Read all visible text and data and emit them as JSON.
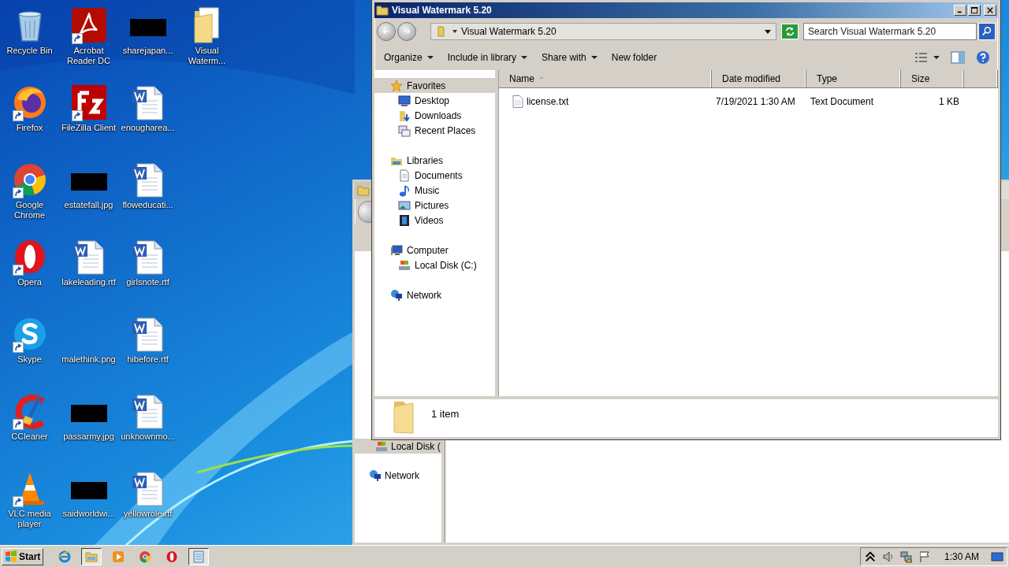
{
  "desktop": {
    "icons": [
      {
        "label": "Recycle Bin",
        "kind": "recycle-bin",
        "shortcut": false
      },
      {
        "label": "Firefox",
        "kind": "firefox",
        "shortcut": true
      },
      {
        "label": "Google Chrome",
        "kind": "chrome",
        "shortcut": true
      },
      {
        "label": "Opera",
        "kind": "opera",
        "shortcut": true
      },
      {
        "label": "Skype",
        "kind": "skype",
        "shortcut": true
      },
      {
        "label": "CCleaner",
        "kind": "ccleaner",
        "shortcut": true
      },
      {
        "label": "VLC media player",
        "kind": "vlc",
        "shortcut": true
      },
      {
        "label": "Acrobat Reader DC",
        "kind": "acrobat",
        "shortcut": true
      },
      {
        "label": "FileZilla Client",
        "kind": "filezilla",
        "shortcut": true
      },
      {
        "label": "estatefall.jpg",
        "kind": "redacted",
        "shortcut": false
      },
      {
        "label": "lakeleading.rtf",
        "kind": "word-doc",
        "shortcut": false
      },
      {
        "label": "malethink.png",
        "kind": "blank-image",
        "shortcut": false
      },
      {
        "label": "passarmy.jpg",
        "kind": "redacted",
        "shortcut": false
      },
      {
        "label": "saidworldwi...",
        "kind": "redacted",
        "shortcut": false
      },
      {
        "label": "sharejapan...",
        "kind": "redacted",
        "shortcut": false
      },
      {
        "label": "enougharea...",
        "kind": "word-doc",
        "shortcut": false
      },
      {
        "label": "floweducati...",
        "kind": "word-doc",
        "shortcut": false
      },
      {
        "label": "girlsnote.rtf",
        "kind": "word-doc",
        "shortcut": false
      },
      {
        "label": "hibefore.rtf",
        "kind": "word-doc",
        "shortcut": false
      },
      {
        "label": "unknownmo...",
        "kind": "word-doc",
        "shortcut": false
      },
      {
        "label": "yellowrole.rtf",
        "kind": "word-doc",
        "shortcut": false
      },
      {
        "label": "Visual Waterm...",
        "kind": "folder",
        "shortcut": false
      }
    ]
  },
  "background_window": {
    "sidebar": {
      "items": [
        {
          "label": "Local Disk (",
          "kind": "disk",
          "selected": true
        },
        {
          "label": "Network",
          "kind": "network",
          "selected": false
        }
      ]
    }
  },
  "window": {
    "title": "Visual Watermark 5.20",
    "address": "Visual Watermark 5.20",
    "search": {
      "placeholder": "Search Visual Watermark 5.20"
    },
    "toolbar": [
      {
        "label": "Organize",
        "dropdown": true
      },
      {
        "label": "Include in library",
        "dropdown": true
      },
      {
        "label": "Share with",
        "dropdown": true
      },
      {
        "label": "New folder",
        "dropdown": false
      }
    ],
    "sidebar": {
      "groups": [
        {
          "label": "Favorites",
          "kind": "star",
          "selected": true,
          "children": [
            {
              "label": "Desktop",
              "kind": "desktop",
              "selected": false
            },
            {
              "label": "Downloads",
              "kind": "downloads",
              "selected": false
            },
            {
              "label": "Recent Places",
              "kind": "recent",
              "selected": false
            }
          ]
        },
        {
          "label": "Libraries",
          "kind": "libraries",
          "selected": false,
          "children": [
            {
              "label": "Documents",
              "kind": "documents",
              "selected": false
            },
            {
              "label": "Music",
              "kind": "music",
              "selected": false
            },
            {
              "label": "Pictures",
              "kind": "pictures",
              "selected": false
            },
            {
              "label": "Videos",
              "kind": "videos",
              "selected": false
            }
          ]
        },
        {
          "label": "Computer",
          "kind": "computer",
          "selected": false,
          "children": [
            {
              "label": "Local Disk (C:)",
              "kind": "disk",
              "selected": false
            }
          ]
        },
        {
          "label": "Network",
          "kind": "network",
          "selected": false
        }
      ]
    },
    "table": {
      "columns": [
        {
          "label": "Name",
          "sorted": true
        },
        {
          "label": "Date modified",
          "sorted": false
        },
        {
          "label": "Type",
          "sorted": false
        },
        {
          "label": "Size",
          "sorted": false
        }
      ],
      "rows": [
        {
          "kind": "text-file",
          "cells": [
            "license.txt",
            "7/19/2021 1:30 AM",
            "Text Document",
            "1 KB"
          ]
        }
      ]
    },
    "details": {
      "count": "1 item"
    }
  },
  "taskbar": {
    "start": "Start",
    "items": [
      {
        "kind": "ie",
        "selected": false
      },
      {
        "kind": "explorer",
        "selected": true
      },
      {
        "kind": "media-player",
        "selected": false
      },
      {
        "kind": "chrome",
        "selected": false
      },
      {
        "kind": "opera",
        "selected": false
      },
      {
        "kind": "notepad",
        "selected": true
      }
    ],
    "clock": "1:30 AM"
  }
}
